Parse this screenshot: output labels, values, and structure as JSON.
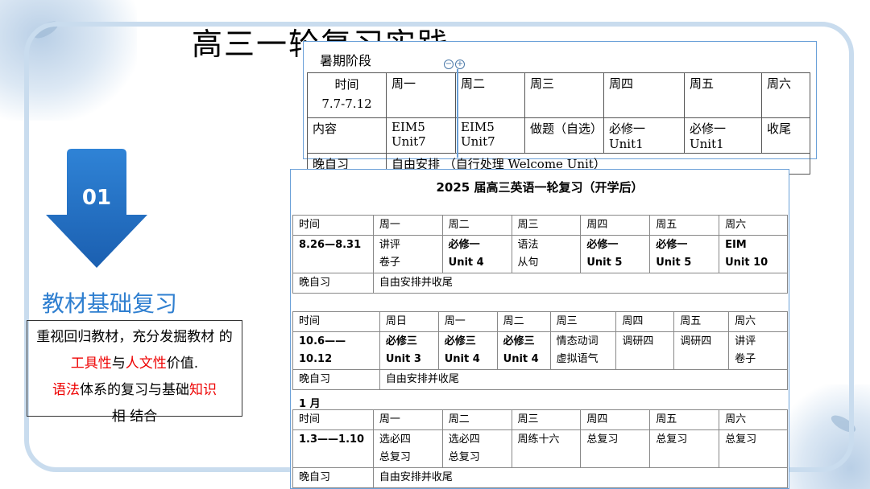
{
  "title": "高三一轮复习实践",
  "arrow_number": "01",
  "section_title": "教材基础复习",
  "description": {
    "p1": "重视回归教材，充分发掘教材 的",
    "p2": "工具性",
    "p3": "与",
    "p4": "人文性",
    "p5": "价值.",
    "p6": "语法",
    "p7": "体系的复习与基础",
    "p8": "知识",
    "p9": "相 结合"
  },
  "summer": {
    "heading": "暑期阶段",
    "header": [
      "时间\n7.7-7.12",
      "周一",
      "周二",
      "周三",
      "周四",
      "周五",
      "周六"
    ],
    "content_row": [
      "内容",
      "EIM5 Unit7",
      "EIM5 Unit7",
      "做题（自选）",
      "必修一 Unit1",
      "必修一 Unit1",
      "收尾"
    ],
    "evening_label": "晚自习",
    "evening_text": "自由安排 （自行处理 Welcome Unit）"
  },
  "school": {
    "title": "2025 届高三英语一轮复习（开学后）",
    "week1": {
      "header": [
        "时间",
        "周一",
        "周二",
        "周三",
        "周四",
        "周五",
        "周六"
      ],
      "row": [
        "8.26—8.31",
        "讲评\n卷子",
        "必修一\nUnit 4",
        "语法\n从句",
        "必修一\nUnit 5",
        "必修一\nUnit 5",
        "EIM\nUnit 10"
      ],
      "evening_label": "晚自习",
      "evening_text": "自由安排并收尾"
    },
    "week2": {
      "header": [
        "时间",
        "周日",
        "周一",
        "周二",
        "周三",
        "周四",
        "周五",
        "周六"
      ],
      "row": [
        "10.6——10.12",
        "必修三\nUnit 3",
        "必修三\nUnit 4",
        "必修三\nUnit 4",
        "情态动词\n虚拟语气",
        "调研四",
        "调研四",
        "讲评\n卷子"
      ],
      "evening_label": "晚自习",
      "evening_text": "自由安排并收尾"
    },
    "month_label": "1 月",
    "week3": {
      "header": [
        "时间",
        "周一",
        "周二",
        "周三",
        "周四",
        "周五",
        "周六"
      ],
      "row": [
        "1.3——1.10",
        "选必四\n总复习",
        "选必四\n总复习",
        "周练十六",
        "总复习",
        "总复习",
        "总复习"
      ],
      "evening_label": "晚自习",
      "evening_text": "自由安排并收尾"
    }
  },
  "colors": {
    "accent": "#2f7fd0",
    "highlight": "#e00000",
    "frame": "#c9dcee"
  }
}
